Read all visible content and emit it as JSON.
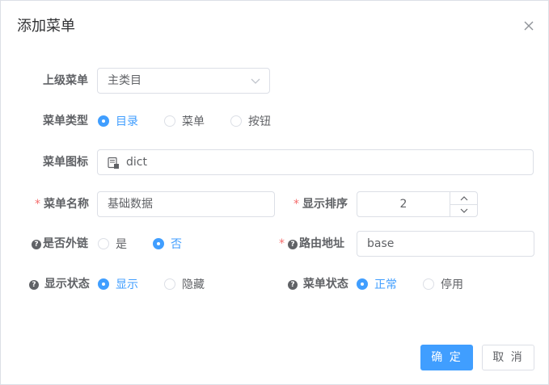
{
  "dialog": {
    "title": "添加菜单"
  },
  "form": {
    "parent_menu": {
      "label": "上级菜单",
      "value": "主类目"
    },
    "menu_type": {
      "label": "菜单类型",
      "options": [
        "目录",
        "菜单",
        "按钮"
      ],
      "selected": "目录"
    },
    "menu_icon": {
      "label": "菜单图标",
      "value": "dict"
    },
    "menu_name": {
      "label": "菜单名称",
      "required": "*",
      "value": "基础数据"
    },
    "sort_order": {
      "label": "显示排序",
      "required": "*",
      "value": "2"
    },
    "is_external": {
      "label": "是否外链",
      "help": "?",
      "options": [
        "是",
        "否"
      ],
      "selected": "否"
    },
    "route_path": {
      "label": "路由地址",
      "required": "*",
      "help": "?",
      "value": "base"
    },
    "display_status": {
      "label": "显示状态",
      "help": "?",
      "options": [
        "显示",
        "隐藏"
      ],
      "selected": "显示"
    },
    "menu_status": {
      "label": "菜单状态",
      "help": "?",
      "options": [
        "正常",
        "停用"
      ],
      "selected": "正常"
    }
  },
  "footer": {
    "confirm_label": "确 定",
    "cancel_label": "取 消"
  },
  "colors": {
    "primary": "#409eff",
    "required": "#f56c6c",
    "border": "#dcdfe6",
    "text": "#606266"
  }
}
